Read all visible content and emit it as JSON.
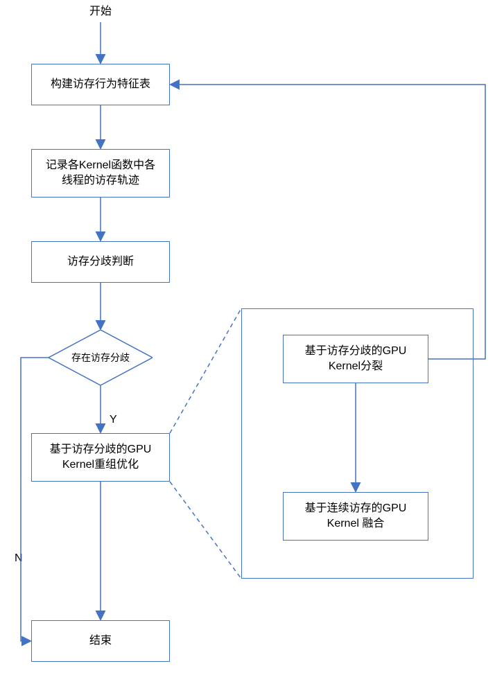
{
  "start": "开始",
  "box1": "构建访存行为特征表",
  "box2_line1": "记录各Kernel函数中各",
  "box2_line2": "线程的访存轨迹",
  "box3": "访存分歧判断",
  "decision": "存在访存分歧",
  "box4_line1": "基于访存分歧的GPU",
  "box4_line2": "Kernel重组优化",
  "end": "结束",
  "sub1_line1": "基于访存分歧的GPU",
  "sub1_line2": "Kernel分裂",
  "sub2_line1": "基于连续访存的GPU",
  "sub2_line2": "Kernel 融合",
  "Y": "Y",
  "N": "N",
  "colors": {
    "stroke": "#4472c4",
    "fill": "#4472c4"
  }
}
